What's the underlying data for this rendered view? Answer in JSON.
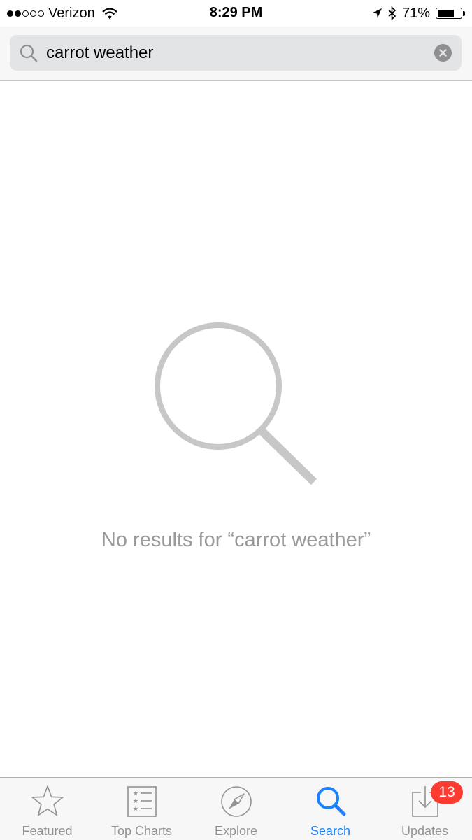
{
  "status_bar": {
    "signal_filled": 2,
    "signal_total": 5,
    "carrier": "Verizon",
    "time": "8:29 PM",
    "battery_text": "71%",
    "battery_level": 0.71
  },
  "search": {
    "query": "carrot weather",
    "icon": "search-icon"
  },
  "empty_state": {
    "icon": "magnifier-icon",
    "message": "No results for “carrot weather”"
  },
  "tabs": [
    {
      "label": "Featured",
      "icon": "star-icon",
      "active": false
    },
    {
      "label": "Top Charts",
      "icon": "list-icon",
      "active": false
    },
    {
      "label": "Explore",
      "icon": "compass-icon",
      "active": false
    },
    {
      "label": "Search",
      "icon": "search-icon",
      "active": true
    },
    {
      "label": "Updates",
      "icon": "download-tray-icon",
      "active": false,
      "badge": "13"
    }
  ],
  "colors": {
    "accent": "#1a82fb",
    "inactive": "#929292",
    "badge": "#fe3b30",
    "empty_icon": "#c7c7c7"
  }
}
